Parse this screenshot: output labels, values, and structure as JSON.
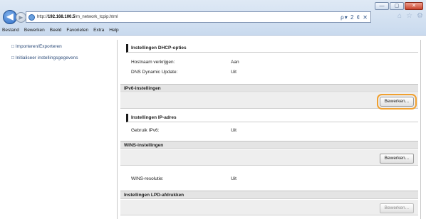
{
  "window": {
    "controls": {
      "minimize": "—",
      "maximize": "▢",
      "close": "✕"
    }
  },
  "browser": {
    "back_glyph": "◀",
    "forward_glyph": "▶",
    "url_prefix": "http://",
    "url_host": "192.168.100.5",
    "url_path": "/m_network_tcpip.html",
    "address_controls": "ρ▾ 2 ¢ ✕",
    "tool_icons": [
      "home-icon",
      "star-icon",
      "gear-icon"
    ],
    "tool_glyphs": [
      "⌂",
      "☆",
      "⚙"
    ]
  },
  "menu": [
    "Bestand",
    "Bewerken",
    "Beeld",
    "Favorieten",
    "Extra",
    "Help"
  ],
  "sidebar": {
    "items": [
      {
        "label": "Importeren/Exporteren"
      },
      {
        "label": "Initialiseer instellingsgegevens"
      }
    ]
  },
  "content": {
    "dhcp": {
      "title": "Instellingen DHCP-opties",
      "rows": [
        {
          "label": "Hostnaam verkrijgen:",
          "value": "Aan"
        },
        {
          "label": "DNS Dynamic Update:",
          "value": "Uit"
        }
      ]
    },
    "ipv6": {
      "title": "IPv6-instellingen",
      "button": "Bewerken..."
    },
    "ipaddr": {
      "title": "Instellingen IP-adres",
      "rows": [
        {
          "label": "Gebruik IPv6:",
          "value": "Uit"
        }
      ]
    },
    "wins": {
      "title": "WINS-instellingen",
      "button": "Bewerken...",
      "rows": [
        {
          "label": "WINS-resolutie:",
          "value": "Uit"
        }
      ]
    },
    "lpd": {
      "title": "Instellingen LPD-afdrukken",
      "button": "Bewerken..."
    }
  },
  "colors": {
    "highlight": "#f0a030",
    "link": "#2d4c7a",
    "header_bg": "#e4e4e4"
  }
}
